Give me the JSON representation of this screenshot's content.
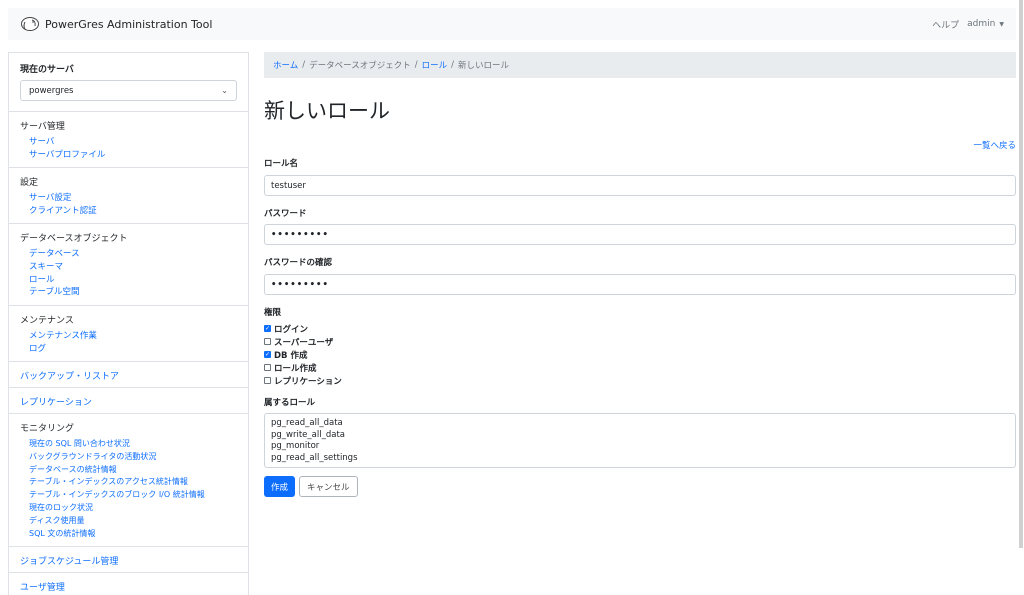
{
  "app": {
    "title": "PowerGres Administration Tool"
  },
  "nav": {
    "help": "ヘルプ",
    "user": "admin"
  },
  "sidebar": {
    "server_title": "現在のサーバ",
    "server_selected": "powergres",
    "sections": {
      "server_mgmt": {
        "title": "サーバ管理",
        "items": [
          "サーバ",
          "サーバプロファイル"
        ]
      },
      "settings": {
        "title": "設定",
        "items": [
          "サーバ設定",
          "クライアント認証"
        ]
      },
      "db_objects": {
        "title": "データベースオブジェクト",
        "items": [
          "データベース",
          "スキーマ",
          "ロール",
          "テーブル空間"
        ]
      },
      "maintenance": {
        "title": "メンテナンス",
        "items": [
          "メンテナンス作業",
          "ログ"
        ]
      },
      "backup": {
        "title": "バックアップ・リストア"
      },
      "replication": {
        "title": "レプリケーション"
      },
      "monitoring": {
        "title": "モニタリング",
        "items": [
          "現在の SQL 問い合わせ状況",
          "バックグラウンドライタの活動状況",
          "データベースの統計情報",
          "テーブル・インデックスのアクセス統計情報",
          "テーブル・インデックスのブロック I/O 統計情報",
          "現在のロック状況",
          "ディスク使用量",
          "SQL 文の統計情報"
        ]
      },
      "job_schedule": {
        "title": "ジョブスケジュール管理"
      },
      "user_mgmt": {
        "title": "ユーザ管理"
      }
    }
  },
  "breadcrumb": {
    "home": "ホーム",
    "db_objects": "データベースオブジェクト",
    "roles": "ロール",
    "current": "新しいロール",
    "sep": "/"
  },
  "page": {
    "title": "新しいロール",
    "back_link": "一覧へ戻る",
    "role_name_label": "ロール名",
    "role_name_value": "testuser",
    "password_label": "パスワード",
    "password_value": "•••••••••",
    "password_confirm_label": "パスワードの確認",
    "password_confirm_value": "•••••••••",
    "permissions_label": "権限",
    "permissions": [
      {
        "label": "ログイン",
        "checked": true
      },
      {
        "label": "スーパーユーザ",
        "checked": false
      },
      {
        "label": "DB 作成",
        "checked": true
      },
      {
        "label": "ロール作成",
        "checked": false
      },
      {
        "label": "レプリケーション",
        "checked": false
      }
    ],
    "member_of_label": "属するロール",
    "member_of_options": [
      "pg_read_all_data",
      "pg_write_all_data",
      "pg_monitor",
      "pg_read_all_settings"
    ],
    "create_button": "作成",
    "cancel_button": "キャンセル"
  }
}
